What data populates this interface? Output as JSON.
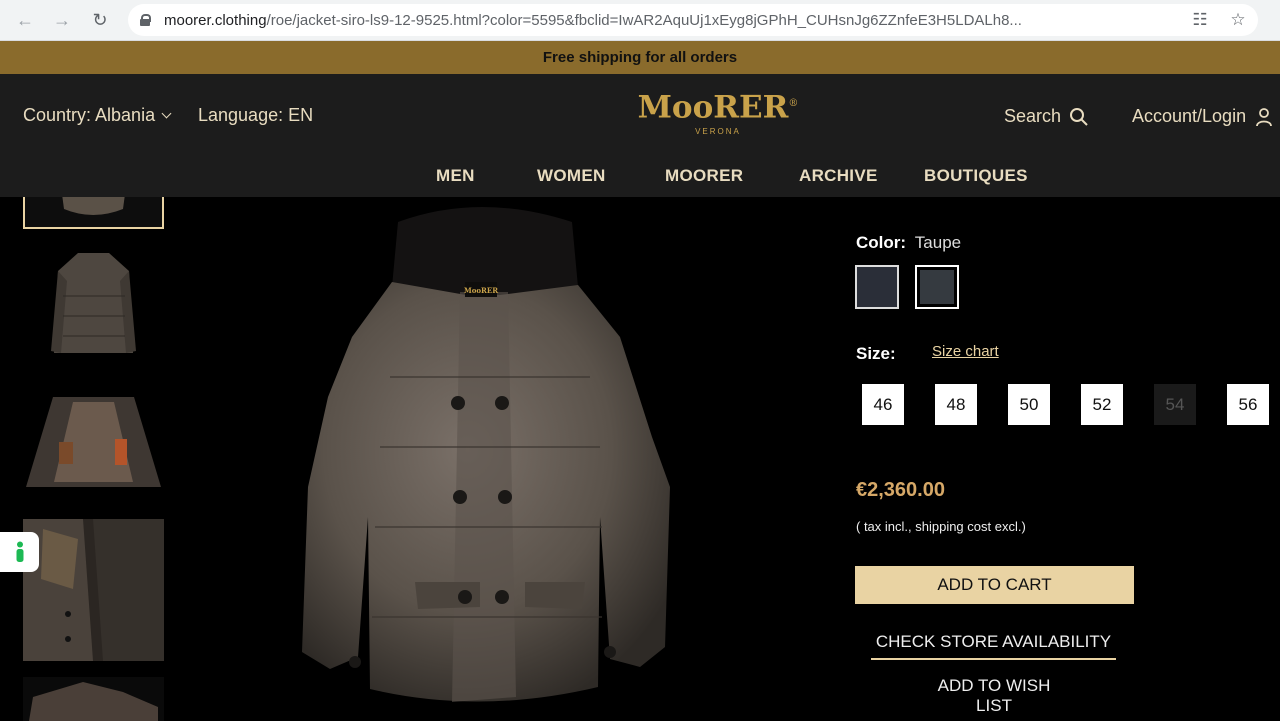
{
  "browser": {
    "url_host": "moorer.clothing",
    "url_path": "/roe/jacket-siro-ls9-12-9525.html?color=5595&fbclid=IwAR2AquUj1xEyg8jGPhH_CUHsnJg6ZZnfeE3H5LDALh8..."
  },
  "announcement": "Free shipping for all orders",
  "header": {
    "country": "Country: Albania",
    "language": "Language: EN",
    "logo_text": "MooRER",
    "logo_mark": "®",
    "logo_sub": "VERONA",
    "search": "Search",
    "account": "Account/Login"
  },
  "nav": [
    "MEN",
    "WOMEN",
    "MOORER",
    "ARCHIVE",
    "BOUTIQUES"
  ],
  "product": {
    "color_label": "Color:",
    "color_value": "Taupe",
    "swatch_colors": [
      "#2a2e38",
      "#353a40"
    ],
    "size_label": "Size:",
    "size_chart": "Size chart",
    "sizes": [
      "46",
      "48",
      "50",
      "52",
      "54",
      "56"
    ],
    "unavailable_size": "54",
    "price": "€2,360.00",
    "tax_note": "( tax incl., shipping cost excl.)",
    "add_to_cart": "ADD TO CART",
    "check_store": "CHECK STORE AVAILABILITY",
    "wish_list": "ADD TO WISH LIST",
    "image_logo": "MooRER"
  },
  "colors": {
    "gold": "#c9a24a",
    "cream": "#e9d3a3",
    "price": "#d6a867",
    "announce_bg": "#8a6b2c"
  }
}
